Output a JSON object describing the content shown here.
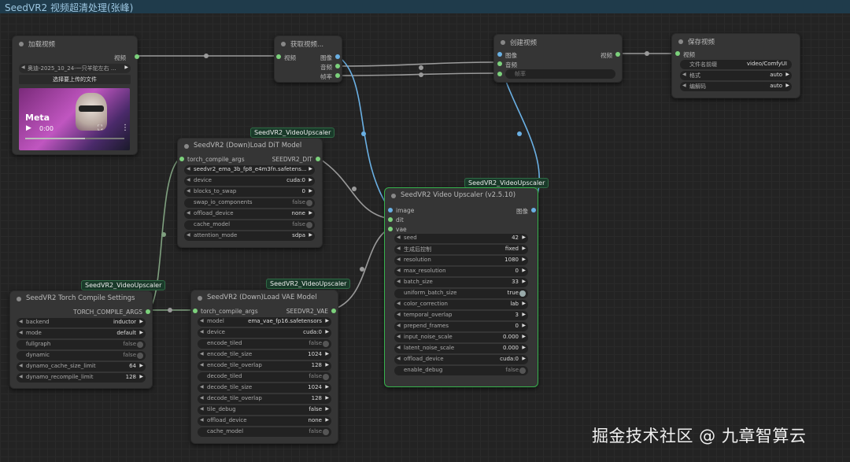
{
  "app": {
    "title": "SeedVR2 视频超清处理(张峰)"
  },
  "colors": {
    "link": "#6ab0e4",
    "link_gray": "#9a9a9a",
    "link_green": "#7fa07f",
    "selected": "#37b24d"
  },
  "nodes": {
    "load_video": {
      "title": "加载视频",
      "output_label": "视频",
      "file_name": "奥迪-2025_10_24-一只羊驼左右 ...",
      "upload_label": "选择要上传的文件",
      "player": {
        "time": "0:00",
        "brand": "Meta"
      }
    },
    "get_info": {
      "title": "获取视频...",
      "input_label": "视频",
      "outputs": [
        "图像",
        "音频",
        "帧率"
      ]
    },
    "create_video": {
      "title": "创建视频",
      "inputs": [
        "图像",
        "音频"
      ],
      "output_label": "视频",
      "fps_label": "帧率"
    },
    "save_video": {
      "title": "保存视频",
      "input_label": "视频",
      "widgets": [
        {
          "label": "文件名前缀",
          "value": "video/ComfyUI"
        },
        {
          "label": "格式",
          "value": "auto"
        },
        {
          "label": "编解码",
          "value": "auto"
        }
      ]
    },
    "dit_loader": {
      "badge": "SeedVR2_VideoUpscaler",
      "title": "SeedVR2 (Down)Load DiT Model",
      "input_label": "torch_compile_args",
      "output_label": "SEEDVR2_DIT",
      "widgets": [
        {
          "label": "",
          "value": "seedvr2_ema_3b_fp8_e4m3fn.safetens..."
        },
        {
          "label": "device",
          "value": "cuda:0"
        },
        {
          "label": "blocks_to_swap",
          "value": "0"
        },
        {
          "label": "swap_io_components",
          "value": "false"
        },
        {
          "label": "offload_device",
          "value": "none"
        },
        {
          "label": "cache_model",
          "value": "false"
        },
        {
          "label": "attention_mode",
          "value": "sdpa"
        }
      ]
    },
    "torch_compile": {
      "badge": "SeedVR2_VideoUpscaler",
      "title": "SeedVR2 Torch Compile Settings",
      "output_label": "TORCH_COMPILE_ARGS",
      "widgets": [
        {
          "label": "backend",
          "value": "inductor"
        },
        {
          "label": "mode",
          "value": "default"
        },
        {
          "label": "fullgraph",
          "value": "false"
        },
        {
          "label": "dynamic",
          "value": "false"
        },
        {
          "label": "dynamo_cache_size_limit",
          "value": "64"
        },
        {
          "label": "dynamo_recompile_limit",
          "value": "128"
        }
      ]
    },
    "vae_loader": {
      "badge": "SeedVR2_VideoUpscaler",
      "title": "SeedVR2 (Down)Load VAE Model",
      "input_label": "torch_compile_args",
      "output_label": "SEEDVR2_VAE",
      "widgets": [
        {
          "label": "model",
          "value": "ema_vae_fp16.safetensors"
        },
        {
          "label": "device",
          "value": "cuda:0"
        },
        {
          "label": "encode_tiled",
          "value": "false"
        },
        {
          "label": "encode_tile_size",
          "value": "1024"
        },
        {
          "label": "encode_tile_overlap",
          "value": "128"
        },
        {
          "label": "decode_tiled",
          "value": "false"
        },
        {
          "label": "decode_tile_size",
          "value": "1024"
        },
        {
          "label": "decode_tile_overlap",
          "value": "128"
        },
        {
          "label": "tile_debug",
          "value": "false"
        },
        {
          "label": "offload_device",
          "value": "none"
        },
        {
          "label": "cache_model",
          "value": "false"
        }
      ]
    },
    "upscaler": {
      "badge": "SeedVR2_VideoUpscaler",
      "title": "SeedVR2 Video Upscaler (v2.5.10)",
      "inputs": [
        "image",
        "dit",
        "vae"
      ],
      "output_label": "图像",
      "widgets": [
        {
          "label": "seed",
          "value": "42"
        },
        {
          "label": "生成后控制",
          "value": "fixed"
        },
        {
          "label": "resolution",
          "value": "1080"
        },
        {
          "label": "max_resolution",
          "value": "0"
        },
        {
          "label": "batch_size",
          "value": "33"
        },
        {
          "label": "uniform_batch_size",
          "value": "true"
        },
        {
          "label": "color_correction",
          "value": "lab"
        },
        {
          "label": "temporal_overlap",
          "value": "3"
        },
        {
          "label": "prepend_frames",
          "value": "0"
        },
        {
          "label": "input_noise_scale",
          "value": "0.000"
        },
        {
          "label": "latent_noise_scale",
          "value": "0.000"
        },
        {
          "label": "offload_device",
          "value": "cuda:0"
        },
        {
          "label": "enable_debug",
          "value": "false"
        }
      ]
    }
  },
  "watermark": "掘金技术社区 @ 九章智算云"
}
